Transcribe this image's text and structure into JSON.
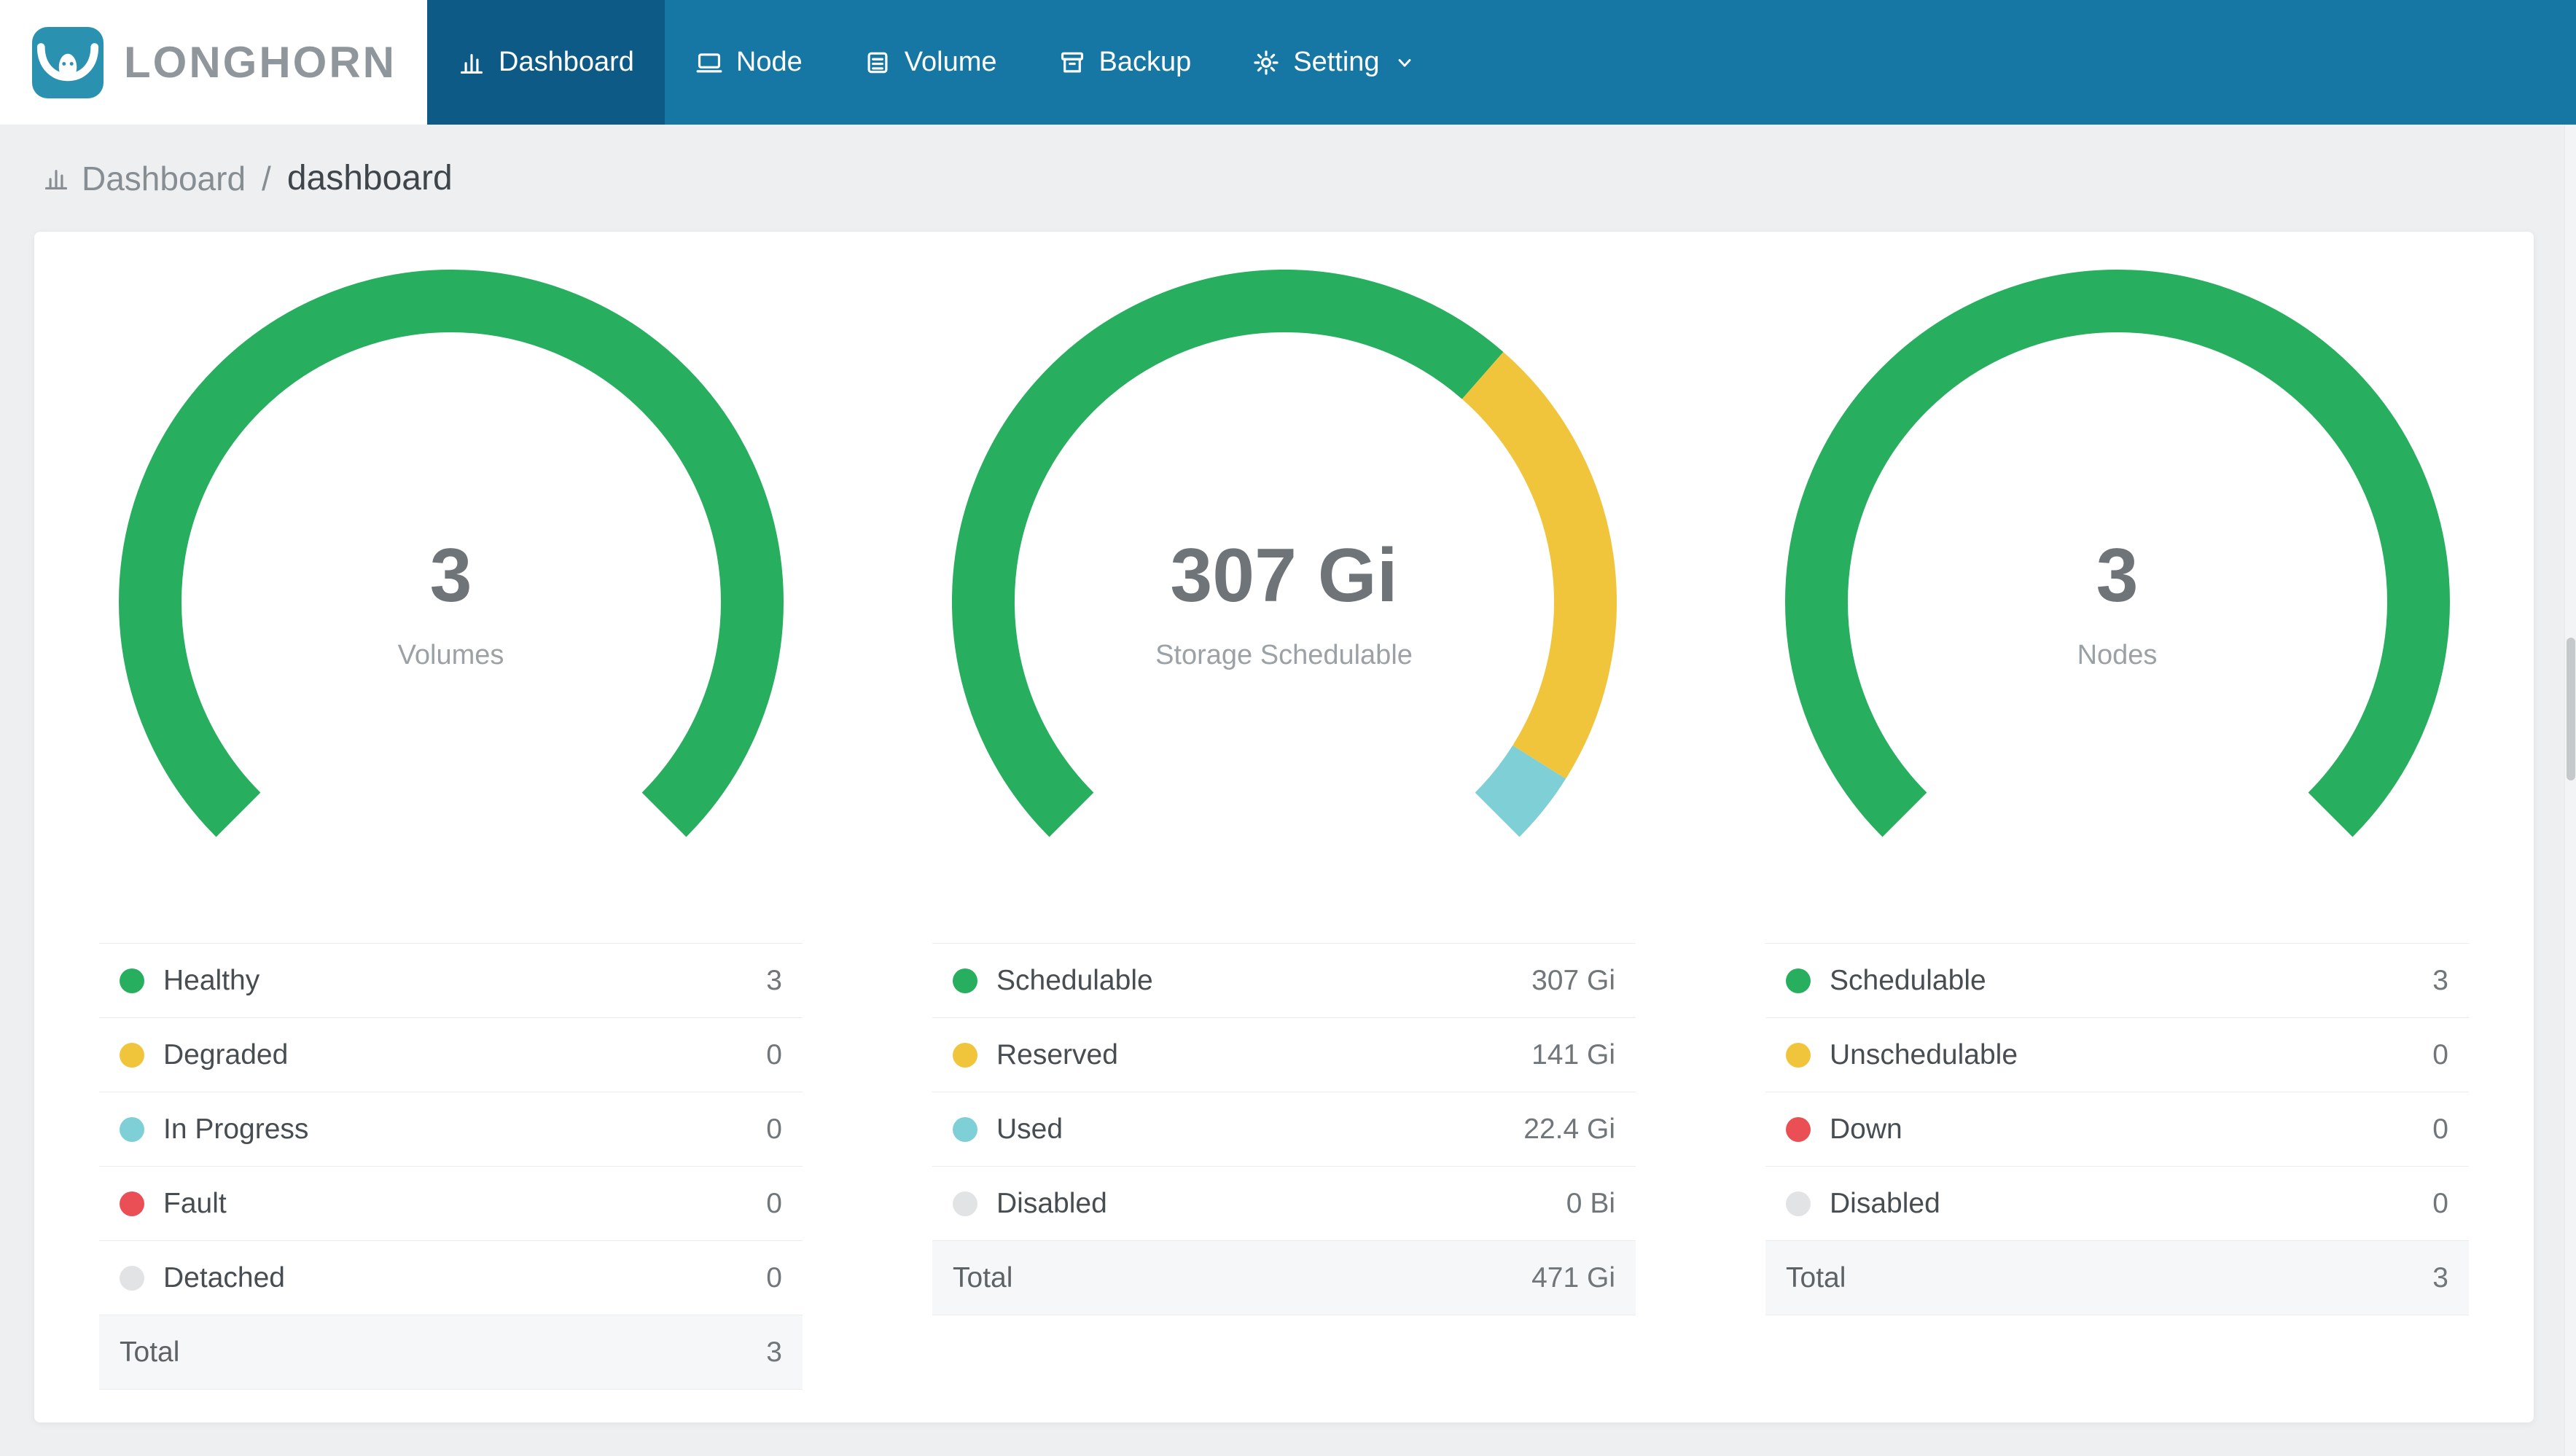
{
  "brand": {
    "name": "LONGHORN"
  },
  "nav": {
    "items": [
      {
        "label": "Dashboard",
        "icon": "bar-chart-icon",
        "active": true
      },
      {
        "label": "Node",
        "icon": "node-icon",
        "active": false
      },
      {
        "label": "Volume",
        "icon": "volume-icon",
        "active": false
      },
      {
        "label": "Backup",
        "icon": "backup-icon",
        "active": false
      },
      {
        "label": "Setting",
        "icon": "gear-icon",
        "active": false,
        "has_dropdown": true
      }
    ]
  },
  "breadcrumb": {
    "section": "Dashboard",
    "separator": "/",
    "page": "dashboard"
  },
  "colors": {
    "navbar": "#1677a5",
    "navbar_active": "#0d5a86",
    "logo_teal": "#2a92b0",
    "healthy_green": "#27ae5f",
    "warning_yellow": "#f0c53c",
    "info_teal": "#7ed0d6",
    "error_red": "#ea4f55",
    "disabled_gray": "#e1e3e5"
  },
  "chart_data": [
    {
      "type": "gauge",
      "center_value": "3",
      "center_label": "Volumes",
      "arc_sweep_deg": 270,
      "legend": [
        {
          "label": "Healthy",
          "value": 3,
          "display": "3",
          "color": "#27ae5f"
        },
        {
          "label": "Degraded",
          "value": 0,
          "display": "0",
          "color": "#f0c53c"
        },
        {
          "label": "In Progress",
          "value": 0,
          "display": "0",
          "color": "#7ed0d6"
        },
        {
          "label": "Fault",
          "value": 0,
          "display": "0",
          "color": "#ea4f55"
        },
        {
          "label": "Detached",
          "value": 0,
          "display": "0",
          "color": "#e1e3e5"
        }
      ],
      "total": {
        "label": "Total",
        "value": 3,
        "display": "3"
      }
    },
    {
      "type": "gauge",
      "center_value": "307 Gi",
      "center_label": "Storage Schedulable",
      "arc_sweep_deg": 270,
      "legend": [
        {
          "label": "Schedulable",
          "value": 307,
          "display": "307 Gi",
          "color": "#27ae5f"
        },
        {
          "label": "Reserved",
          "value": 141,
          "display": "141 Gi",
          "color": "#f0c53c"
        },
        {
          "label": "Used",
          "value": 22.4,
          "display": "22.4 Gi",
          "color": "#7ed0d6"
        },
        {
          "label": "Disabled",
          "value": 0,
          "display": "0 Bi",
          "color": "#e1e3e5"
        }
      ],
      "total": {
        "label": "Total",
        "value": 471,
        "display": "471 Gi"
      }
    },
    {
      "type": "gauge",
      "center_value": "3",
      "center_label": "Nodes",
      "arc_sweep_deg": 270,
      "legend": [
        {
          "label": "Schedulable",
          "value": 3,
          "display": "3",
          "color": "#27ae5f"
        },
        {
          "label": "Unschedulable",
          "value": 0,
          "display": "0",
          "color": "#f0c53c"
        },
        {
          "label": "Down",
          "value": 0,
          "display": "0",
          "color": "#ea4f55"
        },
        {
          "label": "Disabled",
          "value": 0,
          "display": "0",
          "color": "#e1e3e5"
        }
      ],
      "total": {
        "label": "Total",
        "value": 3,
        "display": "3"
      }
    }
  ]
}
